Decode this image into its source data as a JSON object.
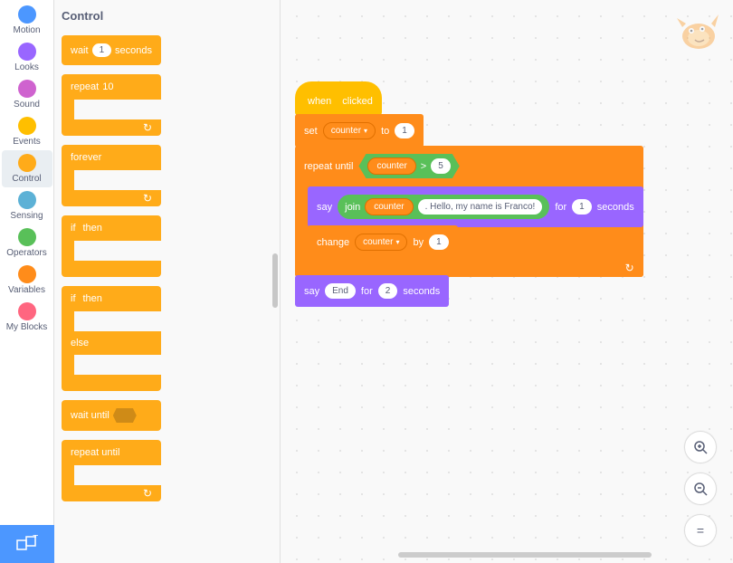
{
  "categories": [
    {
      "label": "Motion",
      "color": "#4C97FF"
    },
    {
      "label": "Looks",
      "color": "#9966FF"
    },
    {
      "label": "Sound",
      "color": "#CF63CF"
    },
    {
      "label": "Events",
      "color": "#FFBF00"
    },
    {
      "label": "Control",
      "color": "#FFAB19"
    },
    {
      "label": "Sensing",
      "color": "#5CB1D6"
    },
    {
      "label": "Operators",
      "color": "#59C059"
    },
    {
      "label": "Variables",
      "color": "#FF8C1A"
    },
    {
      "label": "My Blocks",
      "color": "#FF6680"
    }
  ],
  "selected_category": "Control",
  "palette": {
    "title": "Control",
    "wait_label": "wait",
    "wait_value": "1",
    "wait_suffix": "seconds",
    "repeat_label": "repeat",
    "repeat_value": "10",
    "forever_label": "forever",
    "if_label": "if",
    "then_label": "then",
    "else_label": "else",
    "wait_until_label": "wait until",
    "repeat_until_label": "repeat until"
  },
  "script": {
    "hat": {
      "prefix": "when",
      "suffix": "clicked"
    },
    "set": {
      "label": "set",
      "var": "counter",
      "to": "to",
      "value": "1"
    },
    "repeat_until": {
      "label": "repeat until",
      "cond": {
        "var": "counter",
        "op": ">",
        "value": "5"
      },
      "body": {
        "say": {
          "label": "say",
          "join_label": "join",
          "join_a": "counter",
          "join_b": ". Hello, my name is Franco!",
          "for": "for",
          "secs": "1",
          "unit": "seconds"
        },
        "change": {
          "label": "change",
          "var": "counter",
          "by": "by",
          "value": "1"
        }
      }
    },
    "say_end": {
      "label": "say",
      "text": "End",
      "for": "for",
      "secs": "2",
      "unit": "seconds"
    }
  },
  "zoom": {
    "in": "⊕",
    "out": "⊖",
    "reset": "="
  }
}
